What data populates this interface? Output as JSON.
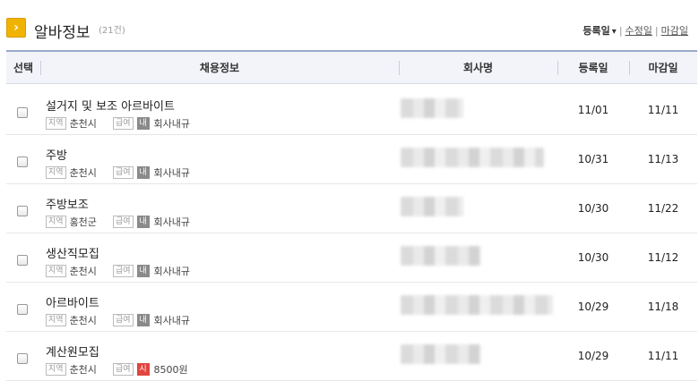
{
  "header": {
    "icon": "chevron-right-icon",
    "title": "알바정보",
    "count": "(21건)",
    "sort": {
      "active": "등록일",
      "option1": "수정일",
      "option2": "마감일"
    }
  },
  "table": {
    "headers": {
      "select": "선택",
      "job": "채용정보",
      "company": "회사명",
      "reg_date": "등록일",
      "deadline": "마감일"
    },
    "rows": [
      {
        "title": "설거지 및 보조 아르바이트",
        "region_tag": "지역",
        "region": "춘천시",
        "pay_tag": "급여",
        "pay_type": "내",
        "pay": "회사내규",
        "pay_color": "#8a8a8a",
        "reg_date": "11/01",
        "deadline": "11/11"
      },
      {
        "title": "주방",
        "region_tag": "지역",
        "region": "춘천시",
        "pay_tag": "급여",
        "pay_type": "내",
        "pay": "회사내규",
        "pay_color": "#8a8a8a",
        "reg_date": "10/31",
        "deadline": "11/13"
      },
      {
        "title": "주방보조",
        "region_tag": "지역",
        "region": "홍천군",
        "pay_tag": "급여",
        "pay_type": "내",
        "pay": "회사내규",
        "pay_color": "#8a8a8a",
        "reg_date": "10/30",
        "deadline": "11/22"
      },
      {
        "title": "생산직모집",
        "region_tag": "지역",
        "region": "춘천시",
        "pay_tag": "급여",
        "pay_type": "내",
        "pay": "회사내규",
        "pay_color": "#8a8a8a",
        "reg_date": "10/30",
        "deadline": "11/12"
      },
      {
        "title": "아르바이트",
        "region_tag": "지역",
        "region": "춘천시",
        "pay_tag": "급여",
        "pay_type": "내",
        "pay": "회사내규",
        "pay_color": "#8a8a8a",
        "reg_date": "10/29",
        "deadline": "11/18"
      },
      {
        "title": "계산원모집",
        "region_tag": "지역",
        "region": "춘천시",
        "pay_tag": "급여",
        "pay_type": "시",
        "pay": "8500원",
        "pay_color": "#e0453e",
        "reg_date": "10/29",
        "deadline": "11/11"
      }
    ]
  }
}
